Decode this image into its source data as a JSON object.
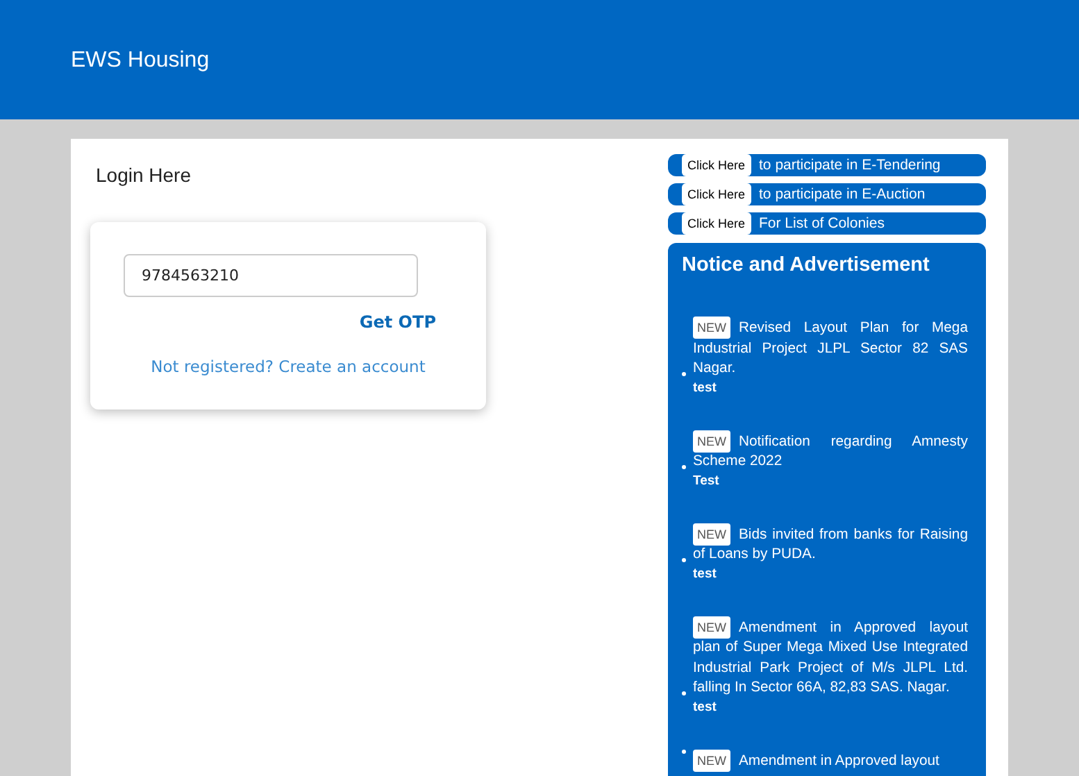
{
  "header": {
    "title": "EWS Housing"
  },
  "login": {
    "title": "Login Here",
    "phone_field": {
      "value": "9784563210"
    },
    "otp_link": "Get OTP",
    "register_link": "Not registered? Create an account"
  },
  "quick_links": [
    {
      "button": "Click Here",
      "text": "to participate in E-Tendering"
    },
    {
      "button": "Click Here",
      "text": "to participate in E-Auction"
    },
    {
      "button": "Click Here",
      "text": "For List of Colonies"
    }
  ],
  "notices": {
    "title": "Notice and Advertisement",
    "items": [
      {
        "badge": "NEW",
        "title": "Revised Layout Plan for Mega Industrial Project JLPL Sector 82 SAS Nagar.",
        "note": "test"
      },
      {
        "badge": "NEW",
        "title": "Notification regarding Amnesty Scheme 2022",
        "note": "Test"
      },
      {
        "badge": "NEW",
        "title": "Bids invited from banks for Raising of Loans by PUDA.",
        "note": "test"
      },
      {
        "badge": "NEW",
        "title": "Amendment in Approved layout plan of Super Mega Mixed Use Integrated Industrial Park Project of M/s JLPL Ltd. falling In Sector 66A, 82,83 SAS. Nagar.",
        "note": "test"
      },
      {
        "badge": "NEW",
        "title": "Amendment in Approved layout"
      }
    ]
  }
}
